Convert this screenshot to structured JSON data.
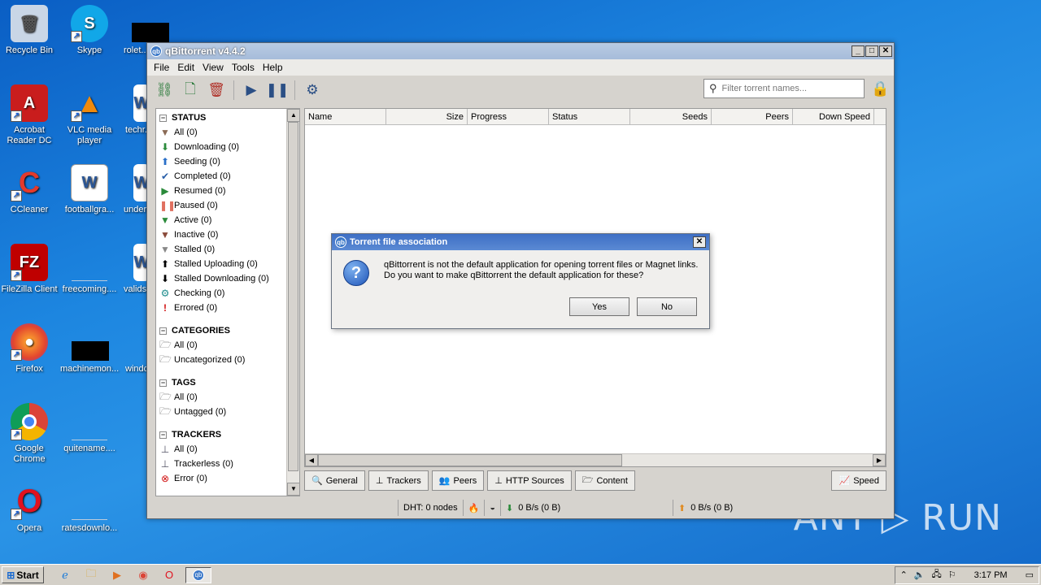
{
  "desktop": {
    "icons": [
      {
        "label": "Recycle Bin"
      },
      {
        "label": "Skype"
      },
      {
        "label": "rolet..."
      },
      {
        "label": "Acrobat Reader DC"
      },
      {
        "label": "VLC media player"
      },
      {
        "label": "techr..."
      },
      {
        "label": "CCleaner"
      },
      {
        "label": "footballgra..."
      },
      {
        "label": "under..."
      },
      {
        "label": "FileZilla Client"
      },
      {
        "label": "freecoming...."
      },
      {
        "label": "valids..."
      },
      {
        "label": "Firefox"
      },
      {
        "label": "machinemon..."
      },
      {
        "label": "windo..."
      },
      {
        "label": "Google Chrome"
      },
      {
        "label": "quitename...."
      },
      {
        "label": "Opera"
      },
      {
        "label": "ratesdownlo..."
      }
    ]
  },
  "window": {
    "title": "qBittorrent v4.4.2",
    "menu": [
      "File",
      "Edit",
      "View",
      "Tools",
      "Help"
    ],
    "search_placeholder": "Filter torrent names..."
  },
  "sidebar": {
    "status": {
      "heading": "STATUS",
      "items": [
        "All (0)",
        "Downloading (0)",
        "Seeding (0)",
        "Completed (0)",
        "Resumed (0)",
        "Paused (0)",
        "Active (0)",
        "Inactive (0)",
        "Stalled (0)",
        "Stalled Uploading (0)",
        "Stalled Downloading (0)",
        "Checking (0)",
        "Errored (0)"
      ]
    },
    "categories": {
      "heading": "CATEGORIES",
      "items": [
        "All (0)",
        "Uncategorized (0)"
      ]
    },
    "tags": {
      "heading": "TAGS",
      "items": [
        "All (0)",
        "Untagged (0)"
      ]
    },
    "trackers": {
      "heading": "TRACKERS",
      "items": [
        "All (0)",
        "Trackerless (0)",
        "Error (0)"
      ]
    }
  },
  "table": {
    "columns": [
      "Name",
      "Size",
      "Progress",
      "Status",
      "Seeds",
      "Peers",
      "Down Speed"
    ]
  },
  "bottom_tabs": [
    "General",
    "Trackers",
    "Peers",
    "HTTP Sources",
    "Content",
    "Speed"
  ],
  "statusbar": {
    "dht": "DHT: 0 nodes",
    "down": "0 B/s (0 B)",
    "up": "0 B/s (0 B)"
  },
  "dialog": {
    "title": "Torrent file association",
    "message_line1": "qBittorrent is not the default application for opening torrent files or Magnet links.",
    "message_line2": "Do you want to make qBittorrent the default application for these?",
    "yes": "Yes",
    "no": "No"
  },
  "taskbar": {
    "start": "Start",
    "clock": "3:17 PM"
  },
  "watermark": "ANY ▷ RUN"
}
